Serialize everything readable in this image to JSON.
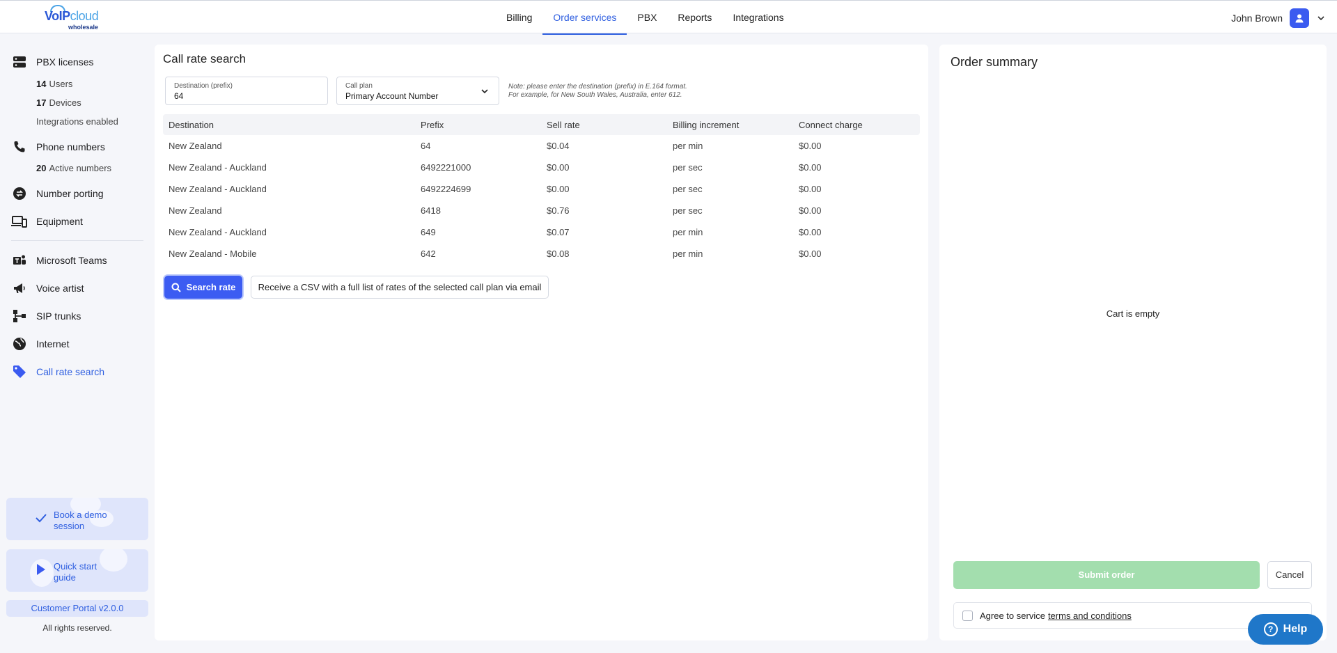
{
  "brand": {
    "logo_main": "VoIP",
    "logo_cloud": "cloud",
    "logo_sub": "wholesale",
    "accent": "#2f5fe0"
  },
  "nav": {
    "items": [
      {
        "label": "Billing"
      },
      {
        "label": "Order services"
      },
      {
        "label": "PBX"
      },
      {
        "label": "Reports"
      },
      {
        "label": "Integrations"
      }
    ],
    "active": "Order services"
  },
  "user": {
    "name": "John Brown"
  },
  "sidebar": {
    "pbx_licenses": "PBX licenses",
    "users_count": "14",
    "users_label": "Users",
    "devices_count": "17",
    "devices_label": "Devices",
    "integrations_enabled": "Integrations enabled",
    "phone_numbers": "Phone numbers",
    "active_count": "20",
    "active_label": "Active numbers",
    "number_porting": "Number porting",
    "equipment": "Equipment",
    "microsoft_teams": "Microsoft Teams",
    "voice_artist": "Voice artist",
    "sip_trunks": "SIP trunks",
    "internet": "Internet",
    "call_rate_search": "Call rate search",
    "book_demo_line1": "Book a demo",
    "book_demo_line2": "session",
    "quick_start_line1": "Quick start",
    "quick_start_line2": "guide",
    "version": "Customer Portal v2.0.0",
    "rights": "All rights reserved."
  },
  "main": {
    "title": "Call rate search",
    "destination": {
      "label": "Destination (prefix)",
      "value": "64"
    },
    "call_plan": {
      "label": "Call plan",
      "value": "Primary Account Number"
    },
    "note_line1": "Note: please enter the destination (prefix) in E.164 format.",
    "note_line2": "For example, for New South Wales, Australia, enter 612.",
    "columns": [
      "Destination",
      "Prefix",
      "Sell rate",
      "Billing increment",
      "Connect charge"
    ],
    "rows": [
      [
        "New Zealand",
        "64",
        "$0.04",
        "per min",
        "$0.00"
      ],
      [
        "New Zealand - Auckland",
        "6492221000",
        "$0.00",
        "per sec",
        "$0.00"
      ],
      [
        "New Zealand - Auckland",
        "6492224699",
        "$0.00",
        "per sec",
        "$0.00"
      ],
      [
        "New Zealand",
        "6418",
        "$0.76",
        "per sec",
        "$0.00"
      ],
      [
        "New Zealand - Auckland",
        "649",
        "$0.07",
        "per min",
        "$0.00"
      ],
      [
        "New Zealand - Mobile",
        "642",
        "$0.08",
        "per min",
        "$0.00"
      ]
    ],
    "search_button": "Search rate",
    "csv_button": "Receive a CSV with a full list of rates of the selected call plan via email"
  },
  "summary": {
    "title": "Order summary",
    "empty": "Cart is empty",
    "submit": "Submit order",
    "cancel": "Cancel",
    "agree_text": "Agree to service",
    "terms_link": "terms and conditions"
  },
  "help": {
    "label": "Help"
  }
}
